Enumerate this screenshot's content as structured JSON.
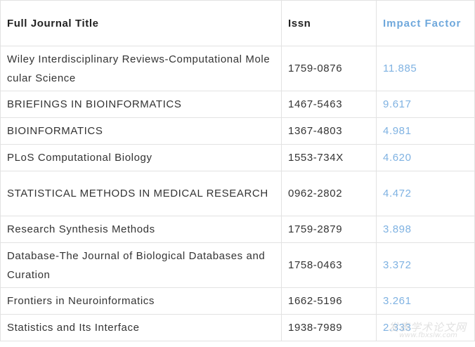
{
  "table": {
    "headers": {
      "title": "Full  Journal Title",
      "issn": "Issn",
      "impact_factor": "Impact Factor"
    },
    "rows": [
      {
        "title": "Wiley Interdisciplinary Reviews-Computational Molecular Science",
        "issn": "1759-0876",
        "impact_factor": "11.885"
      },
      {
        "title": "BRIEFINGS IN BIOINFORMATICS",
        "issn": "1467-5463",
        "impact_factor": "9.617"
      },
      {
        "title": "BIOINFORMATICS",
        "issn": "1367-4803",
        "impact_factor": "4.981"
      },
      {
        "title": "PLoS Computational Biology",
        "issn": "1553-734X",
        "impact_factor": "4.620"
      },
      {
        "title": "STATISTICAL METHODS IN MEDICAL RESEARCH",
        "issn": "0962-2802",
        "impact_factor": "4.472"
      },
      {
        "title": "Research Synthesis Methods",
        "issn": "1759-2879",
        "impact_factor": "3.898"
      },
      {
        "title": "Database-The Journal of Biological Databases and Curation",
        "issn": "1758-0463",
        "impact_factor": "3.372"
      },
      {
        "title": "Frontiers in Neuroinformatics",
        "issn": "1662-5196",
        "impact_factor": "3.261"
      },
      {
        "title": "Statistics and Its Interface",
        "issn": "1938-7989",
        "impact_factor": "2.333"
      }
    ]
  },
  "watermark": {
    "name": "发表学术论文网",
    "url": "www.fbxslw.com"
  },
  "colors": {
    "impact_factor_text": "#7fb2e2",
    "border": "#e2e2e2"
  }
}
